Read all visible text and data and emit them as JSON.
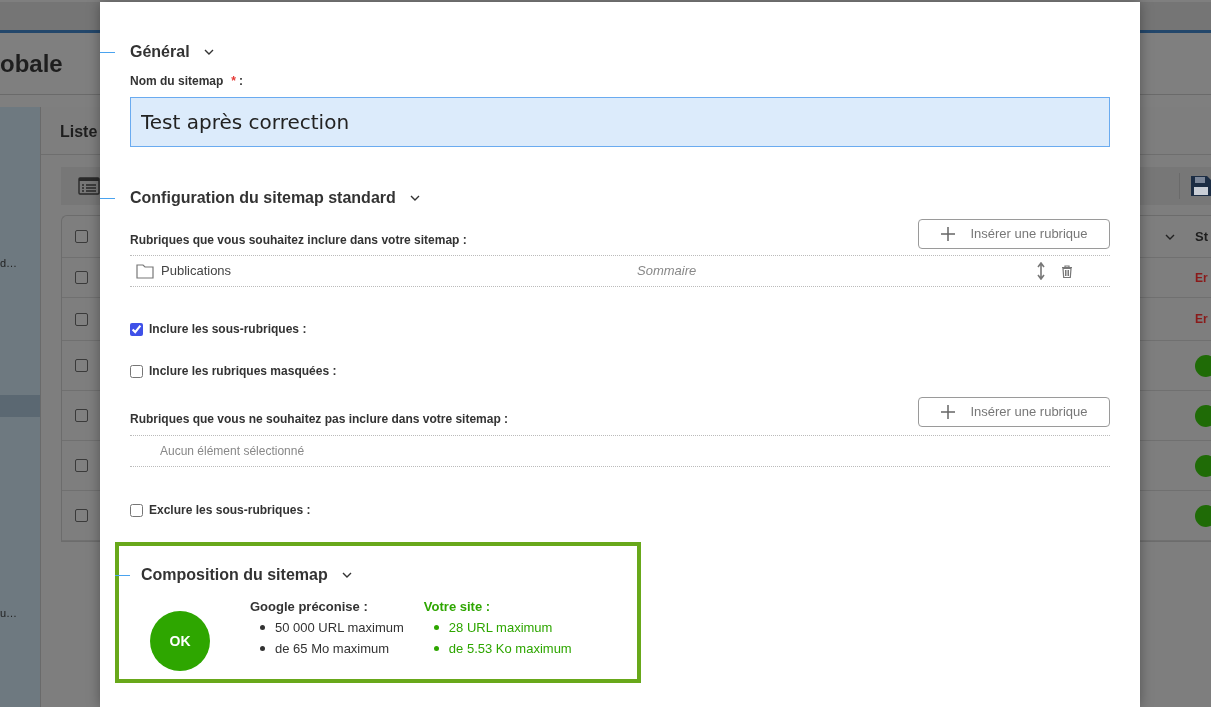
{
  "background": {
    "page_title": "obale",
    "sidebar_items": [
      {
        "text": "d…",
        "selected": false
      },
      {
        "selected": true
      },
      {
        "text": "u…",
        "selected": false
      }
    ],
    "panel_title": "Liste",
    "column_header": "St",
    "header_checked": false,
    "rows": [
      {
        "checked": false,
        "status": {
          "kind": "text",
          "text": "Er"
        }
      },
      {
        "checked": false,
        "status": {
          "kind": "text",
          "text": "Er"
        }
      },
      {
        "checked": false,
        "status": {
          "kind": "badge"
        }
      },
      {
        "checked": false,
        "status": {
          "kind": "badge"
        }
      },
      {
        "checked": false,
        "status": {
          "kind": "badge"
        }
      },
      {
        "checked": false,
        "status": {
          "kind": "badge"
        }
      }
    ]
  },
  "modal": {
    "general": {
      "title": "Général",
      "field_label": "Nom du sitemap",
      "required": true,
      "required_mark": "*",
      "label_suffix": ":",
      "field_value": "Test après correction"
    },
    "standard": {
      "title": "Configuration du sitemap standard",
      "include": {
        "label": "Rubriques que vous souhaitez inclure dans votre sitemap :",
        "button": "Insérer une rubrique",
        "items": [
          {
            "name": "Publications",
            "template": "Sommaire"
          }
        ]
      },
      "options_a": [
        {
          "label": "Inclure les sous-rubriques :",
          "checked": true
        },
        {
          "label": "Inclure les rubriques masquées :",
          "checked": false
        }
      ],
      "exclude": {
        "label": "Rubriques que vous ne souhaitez pas inclure dans votre sitemap :",
        "button": "Insérer une rubrique",
        "empty": "Aucun élément sélectionné"
      },
      "options_b": [
        {
          "label": "Exclure les sous-rubriques :",
          "checked": false
        }
      ]
    },
    "composition": {
      "title": "Composition du sitemap",
      "status": "OK",
      "ok": true,
      "google": {
        "title": "Google préconise :",
        "items": [
          "50 000 URL maximum",
          "de 65 Mo maximum"
        ]
      },
      "site": {
        "title": "Votre site :",
        "items": [
          "28 URL maximum",
          "de 5.53 Ko maximum"
        ]
      }
    }
  }
}
